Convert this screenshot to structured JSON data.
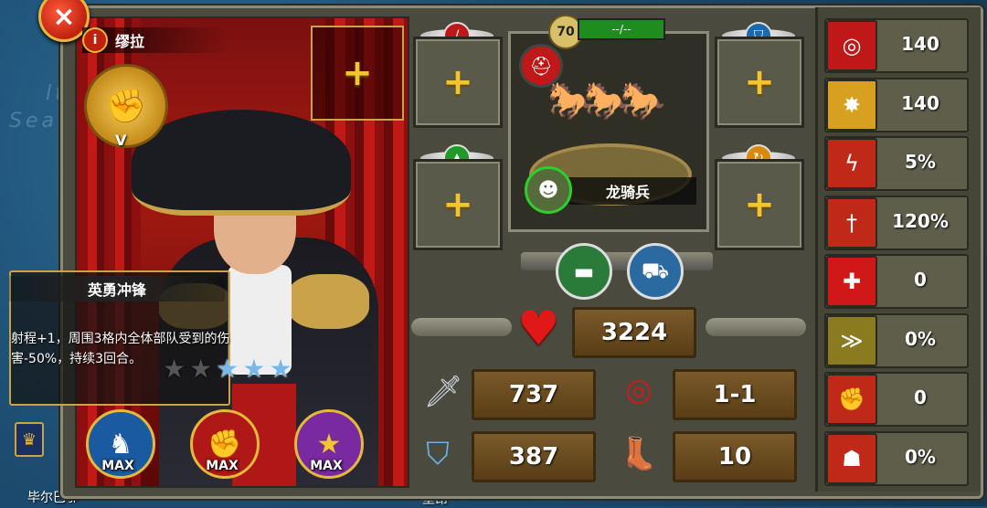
{
  "hero": {
    "name": "缪拉",
    "info_icon": "i",
    "rank_roman": "V"
  },
  "close_icon": "×",
  "skill": {
    "title": "英勇冲锋",
    "description": "射程+1，周围3格内全体部队受到的伤害-50%，持续3回合。",
    "stars_total": 5,
    "stars_filled": 3,
    "star_glyph": "★"
  },
  "skill_badges": [
    {
      "label": "MAX",
      "icon": "horse-icon",
      "glyph": "♞",
      "color": "#1a5aa0"
    },
    {
      "label": "MAX",
      "icon": "fist-icon",
      "glyph": "✊",
      "color": "#b01818"
    },
    {
      "label": "MAX",
      "icon": "star-icon",
      "glyph": "★",
      "color": "#7a2aa0"
    }
  ],
  "equip_plus": "+",
  "troop": {
    "level": "70",
    "hp_text": "--/--",
    "name": "龙骑兵",
    "type_icon": "helmet-icon",
    "avatar_icon": "soldier-icon"
  },
  "units": [
    {
      "icon": "tank-icon",
      "glyph": "▬",
      "color": "#2a7a3a"
    },
    {
      "icon": "jeep-icon",
      "glyph": "⛟",
      "color": "#2a6aa0"
    }
  ],
  "stats": {
    "hp": "3224",
    "attack": "737",
    "range": "1-1",
    "defense": "387",
    "movement": "10"
  },
  "attributes": [
    {
      "icon": "target-icon",
      "glyph": "◎",
      "color": "#c01818",
      "value": "140"
    },
    {
      "icon": "explosion-icon",
      "glyph": "✸",
      "color": "#d8a020",
      "value": "140"
    },
    {
      "icon": "lightning-icon",
      "glyph": "ϟ",
      "color": "#c02818",
      "value": "5%"
    },
    {
      "icon": "sword-fire-icon",
      "glyph": "†",
      "color": "#c02818",
      "value": "120%"
    },
    {
      "icon": "medical-cross-icon",
      "glyph": "✚",
      "color": "#d01818",
      "value": "0"
    },
    {
      "icon": "rank-chevron-icon",
      "glyph": "≫",
      "color": "#8a7a20",
      "value": "0%"
    },
    {
      "icon": "fist-shield-icon",
      "glyph": "✊",
      "color": "#c02818",
      "value": "0"
    },
    {
      "icon": "burning-man-icon",
      "glyph": "☗",
      "color": "#c02818",
      "value": "0%"
    }
  ],
  "map": {
    "city1": "毕尔巴鄂",
    "city2": "里昂"
  }
}
